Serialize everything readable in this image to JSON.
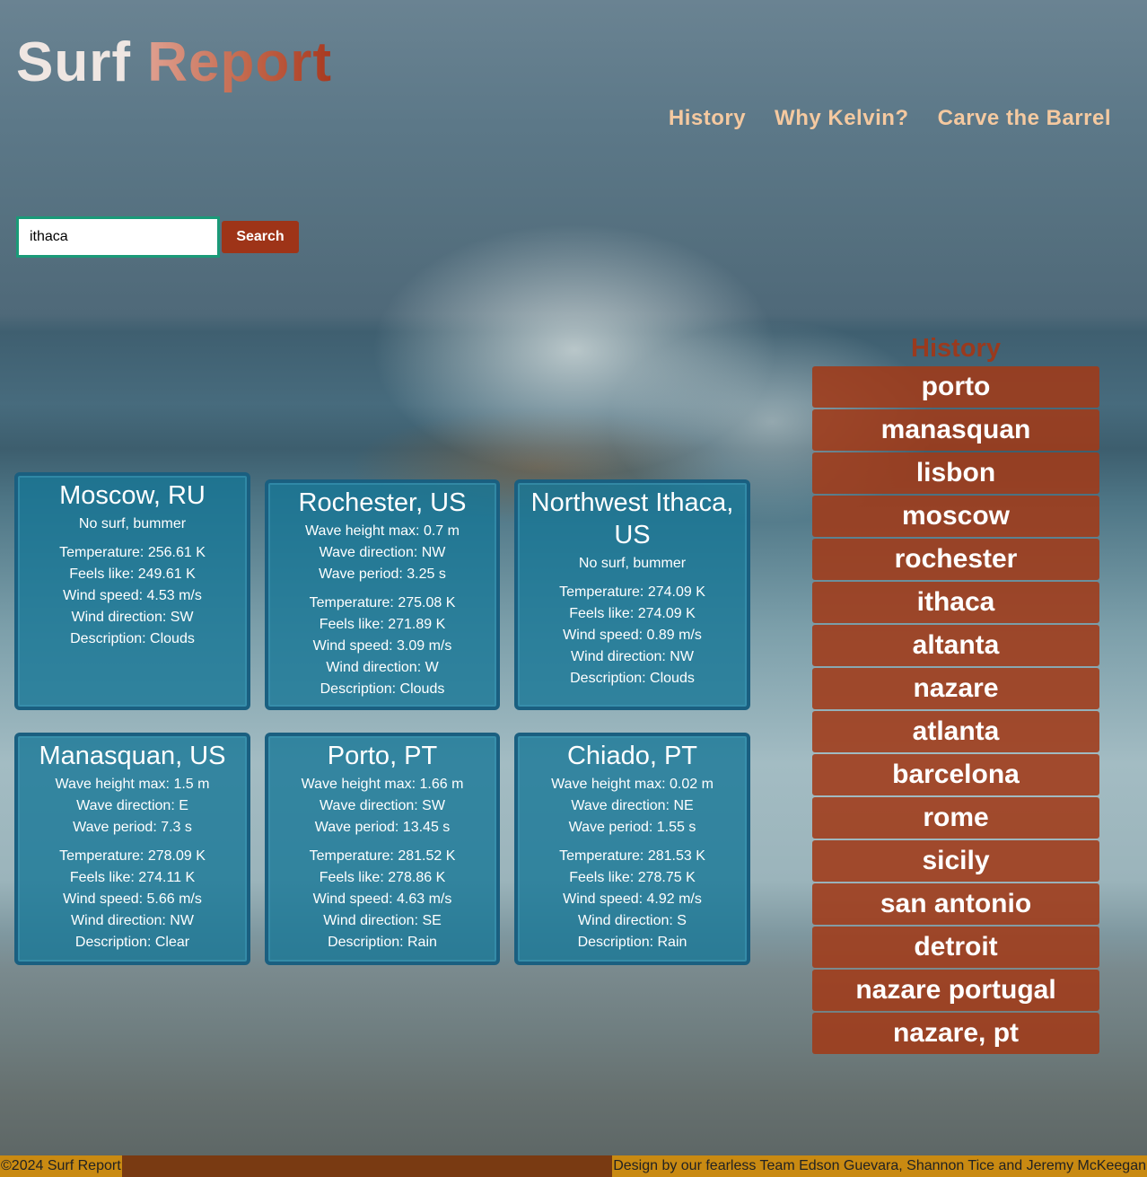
{
  "header": {
    "title_part1": "Surf",
    "title_part2": "Report"
  },
  "nav": {
    "items": [
      "History",
      "Why Kelvin?",
      "Carve the Barrel"
    ]
  },
  "search": {
    "value": "ithaca",
    "button_label": "Search"
  },
  "cards": [
    {
      "city": "Moscow, RU",
      "surf": [
        "No surf, bummer"
      ],
      "weather": [
        "Temperature: 256.61 K",
        "Feels like: 249.61 K",
        "Wind speed: 4.53 m/s",
        "Wind direction: SW",
        "Description: Clouds"
      ]
    },
    {
      "city": "Rochester, US",
      "surf": [
        "Wave height max: 0.7 m",
        "Wave direction: NW",
        "Wave period: 3.25 s"
      ],
      "weather": [
        "Temperature: 275.08 K",
        "Feels like: 271.89 K",
        "Wind speed: 3.09 m/s",
        "Wind direction: W",
        "Description: Clouds"
      ]
    },
    {
      "city": "Northwest Ithaca, US",
      "surf": [
        "No surf, bummer"
      ],
      "weather": [
        "Temperature: 274.09 K",
        "Feels like: 274.09 K",
        "Wind speed: 0.89 m/s",
        "Wind direction: NW",
        "Description: Clouds"
      ]
    },
    {
      "city": "Manasquan, US",
      "surf": [
        "Wave height max: 1.5 m",
        "Wave direction: E",
        "Wave period: 7.3 s"
      ],
      "weather": [
        "Temperature: 278.09 K",
        "Feels like: 274.11 K",
        "Wind speed: 5.66 m/s",
        "Wind direction: NW",
        "Description: Clear"
      ]
    },
    {
      "city": "Porto, PT",
      "surf": [
        "Wave height max: 1.66 m",
        "Wave direction: SW",
        "Wave period: 13.45 s"
      ],
      "weather": [
        "Temperature: 281.52 K",
        "Feels like: 278.86 K",
        "Wind speed: 4.63 m/s",
        "Wind direction: SE",
        "Description: Rain"
      ]
    },
    {
      "city": "Chiado, PT",
      "surf": [
        "Wave height max: 0.02 m",
        "Wave direction: NE",
        "Wave period: 1.55 s"
      ],
      "weather": [
        "Temperature: 281.53 K",
        "Feels like: 278.75 K",
        "Wind speed: 4.92 m/s",
        "Wind direction: S",
        "Description: Rain"
      ]
    }
  ],
  "history": {
    "title": "History",
    "items": [
      "porto",
      "manasquan",
      "lisbon",
      "moscow",
      "rochester",
      "ithaca",
      "altanta",
      "nazare",
      "atlanta",
      "barcelona",
      "rome",
      "sicily",
      "san antonio",
      "detroit",
      "nazare portugal",
      "nazare, pt"
    ]
  },
  "footer": {
    "left": "©2024 Surf Report",
    "right": "Design by our fearless Team Edson Guevara, Shannon Tice and Jeremy McKeegan"
  },
  "colors": {
    "accent": "#9e3418",
    "history_item": "#a03a18",
    "card": "#14769a",
    "nav": "#f5c9a0",
    "footer_bar": "#793a12",
    "footer_text_bg": "#c98a12"
  }
}
